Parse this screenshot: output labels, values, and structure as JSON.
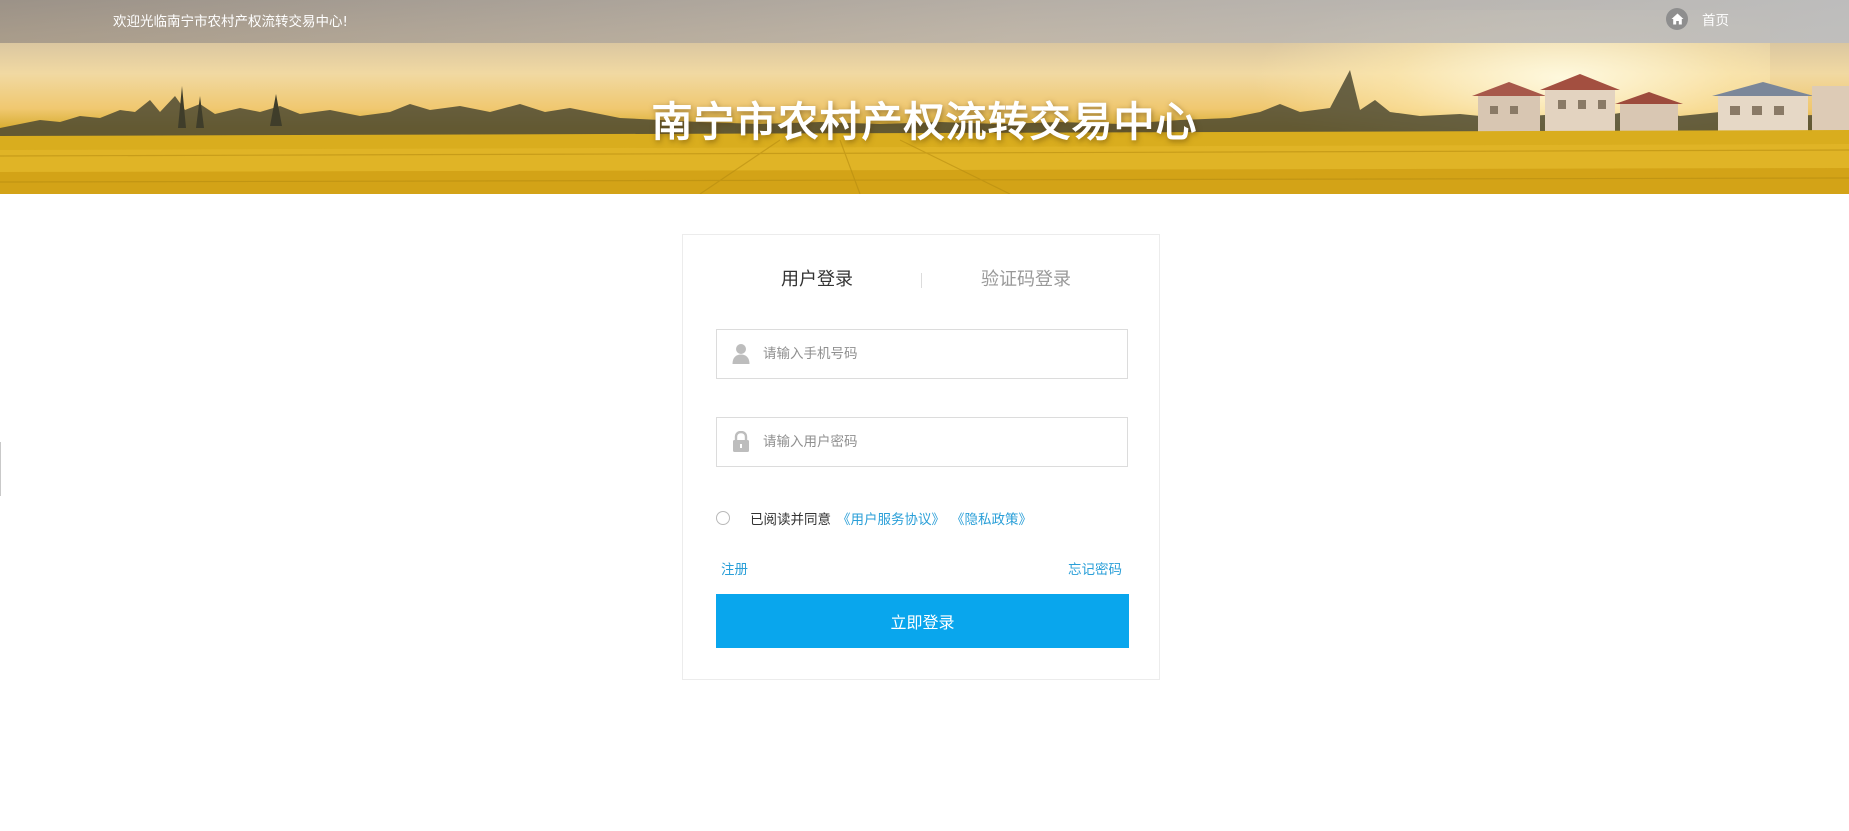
{
  "header": {
    "welcome_text": "欢迎光临南宁市农村产权流转交易中心!",
    "home_icon": "home-icon",
    "home_label": "首页"
  },
  "banner": {
    "title": "南宁市农村产权流转交易中心"
  },
  "login": {
    "tabs": [
      {
        "label": "用户登录",
        "active": true
      },
      {
        "label": "验证码登录",
        "active": false
      }
    ],
    "phone": {
      "icon": "user-icon",
      "placeholder": "请输入手机号码",
      "value": ""
    },
    "password": {
      "icon": "lock-icon",
      "placeholder": "请输入用户密码",
      "value": ""
    },
    "agreement": {
      "checked": false,
      "text": "已阅读并同意",
      "service_link": "《用户服务协议》",
      "privacy_link": "《隐私政策》"
    },
    "register_label": "注册",
    "forgot_label": "忘记密码",
    "submit_label": "立即登录"
  },
  "colors": {
    "accent": "#09a6ed",
    "link": "#2a9fd8"
  }
}
